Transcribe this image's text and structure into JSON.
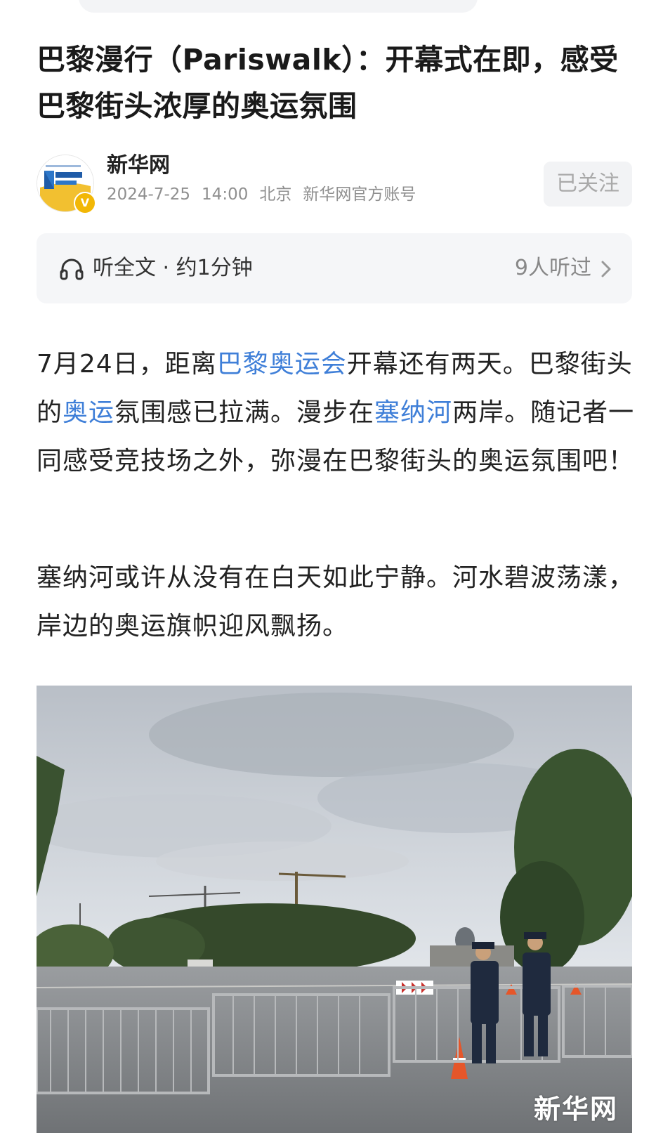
{
  "article": {
    "title": "巴黎漫行（Pariswalk）：开幕式在即，感受巴黎街头浓厚的奥运氛围"
  },
  "author": {
    "name": "新华网",
    "avatar_icon": "xinhua-news-logo",
    "verified_icon": "verified-v-badge",
    "date": "2024-7-25",
    "time": "14:00",
    "location": "北京",
    "account_type": "新华网官方账号",
    "follow_label": "已关注"
  },
  "listen": {
    "label": "听全文 · 约1分钟",
    "count": "9人听过",
    "icon": "headphone-icon"
  },
  "body": {
    "p1": {
      "t1": "7月24日，距离",
      "link1": "巴黎奥运会",
      "t2": "开幕还有两天。巴黎街头的",
      "link2": "奥运",
      "t3": "氛围感已拉满。漫步在",
      "link3": "塞纳河",
      "t4": "两岸。随记者一同感受竞技场之外，弥漫在巴黎街头的奥运氛围吧！"
    },
    "p2": "塞纳河或许从没有在白天如此宁静。河水碧波荡漾，岸边的奥运旗帜迎风飘扬。"
  },
  "photo": {
    "watermark": "新华网"
  },
  "colors": {
    "link": "#3f7fd8",
    "meta_text": "#8f8f8f",
    "panel_bg": "#f5f6f8"
  }
}
